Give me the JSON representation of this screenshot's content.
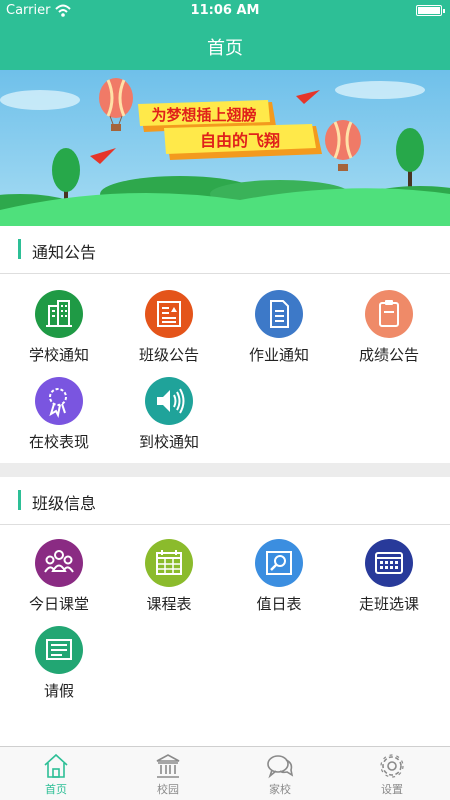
{
  "status_bar": {
    "carrier": "Carrier",
    "time": "11:06 AM"
  },
  "nav": {
    "title": "首页"
  },
  "banner": {
    "line1": "为梦想插上翅膀",
    "line2": "自由的飞翔"
  },
  "notice": {
    "title": "通知公告",
    "items": [
      {
        "label": "学校通知",
        "icon": "school-building-icon",
        "color": "#1f9a45"
      },
      {
        "label": "班级公告",
        "icon": "class-bulletin-icon",
        "color": "#e4541a"
      },
      {
        "label": "作业通知",
        "icon": "homework-document-icon",
        "color": "#3d79c8"
      },
      {
        "label": "成绩公告",
        "icon": "grades-clipboard-icon",
        "color": "#ef8a68"
      },
      {
        "label": "在校表现",
        "icon": "award-ribbon-icon",
        "color": "#7a55e0"
      },
      {
        "label": "到校通知",
        "icon": "speaker-icon",
        "color": "#1fa39a"
      }
    ]
  },
  "class_info": {
    "title": "班级信息",
    "items": [
      {
        "label": "今日课堂",
        "icon": "students-group-icon",
        "color": "#8a2b83"
      },
      {
        "label": "课程表",
        "icon": "timetable-calendar-icon",
        "color": "#8bbb2c"
      },
      {
        "label": "值日表",
        "icon": "duty-search-icon",
        "color": "#3b8ee0"
      },
      {
        "label": "走班选课",
        "icon": "course-select-calendar-icon",
        "color": "#283a9a"
      },
      {
        "label": "请假",
        "icon": "leave-note-icon",
        "color": "#22a673"
      }
    ]
  },
  "tabbar": {
    "tabs": [
      {
        "label": "首页",
        "icon": "home-icon",
        "active": true
      },
      {
        "label": "校园",
        "icon": "campus-building-icon",
        "active": false
      },
      {
        "label": "家校",
        "icon": "chat-bubbles-icon",
        "active": false
      },
      {
        "label": "设置",
        "icon": "gear-icon",
        "active": false
      }
    ],
    "active_color": "#2dbf96"
  },
  "colors": {
    "accent": "#2dbf96",
    "divider": "#ececec"
  }
}
